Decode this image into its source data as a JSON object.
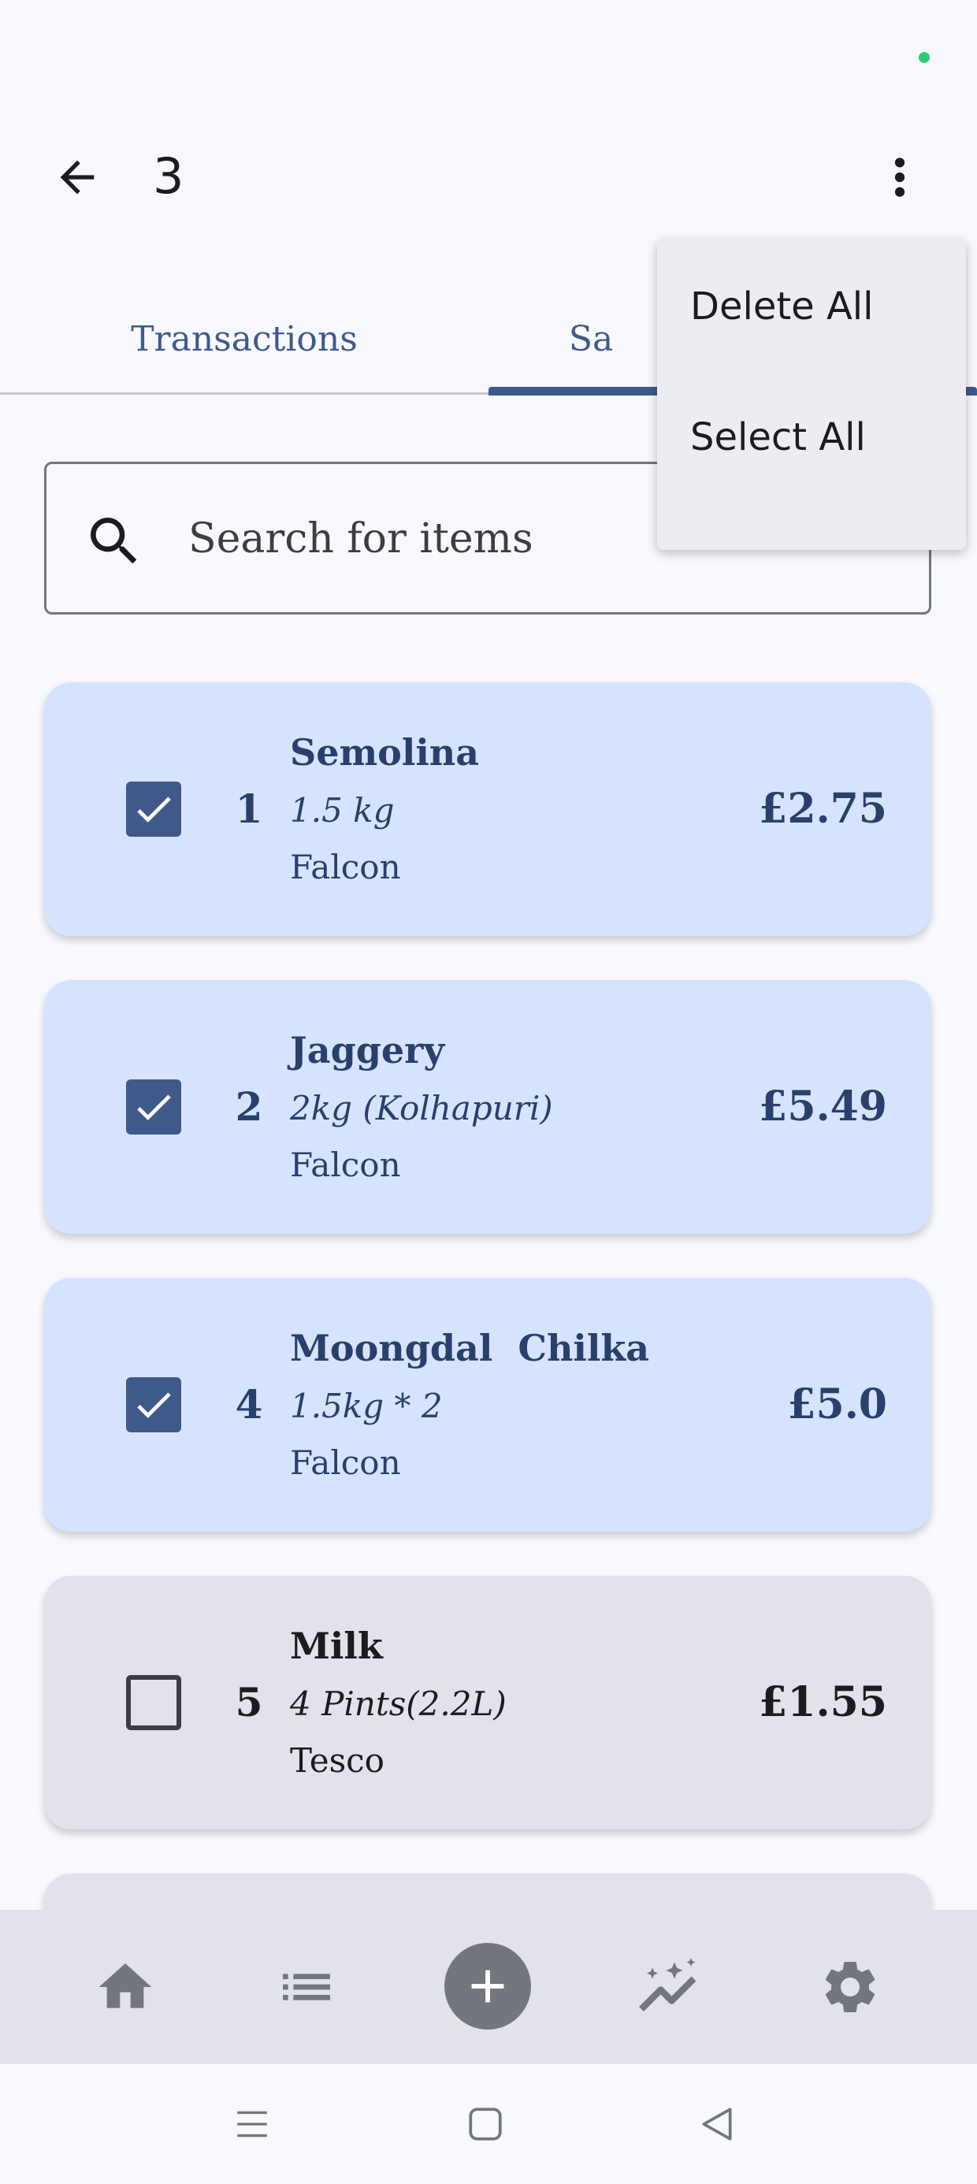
{
  "appbar": {
    "title": "3",
    "back_icon": "arrow-left-icon",
    "more_icon": "more-vert-icon"
  },
  "tabs": [
    {
      "label": "Transactions"
    },
    {
      "label": "Sa"
    }
  ],
  "search": {
    "placeholder": "Search for items",
    "icon": "search-icon"
  },
  "items": [
    {
      "number": "1",
      "name": "Semolina",
      "quantity": "1.5 kg",
      "store": "Falcon",
      "price": "£2.75",
      "checked": true
    },
    {
      "number": "2",
      "name": "Jaggery",
      "quantity": "2kg (Kolhapuri)",
      "store": "Falcon",
      "price": "£5.49",
      "checked": true
    },
    {
      "number": "4",
      "name": "Moongdal  Chilka",
      "quantity": "1.5kg * 2",
      "store": "Falcon",
      "price": "£5.0",
      "checked": true
    },
    {
      "number": "5",
      "name": "Milk",
      "quantity": "4 Pints(2.2L)",
      "store": "Tesco",
      "price": "£1.55",
      "checked": false
    }
  ],
  "menu": {
    "delete_all": "Delete All",
    "select_all": "Select All"
  },
  "bottom_nav": {
    "items": [
      "home-icon",
      "list-icon",
      "add-circle-icon",
      "insights-icon",
      "settings-icon"
    ]
  },
  "system_nav": {
    "items": [
      "menu-icon",
      "home-square-icon",
      "back-triangle-icon"
    ]
  },
  "colors": {
    "accent": "#3f5a8a",
    "selected_card": "#d6e3ff",
    "unselected_card": "#e1e2ea",
    "status_dot": "#2ecc71"
  }
}
